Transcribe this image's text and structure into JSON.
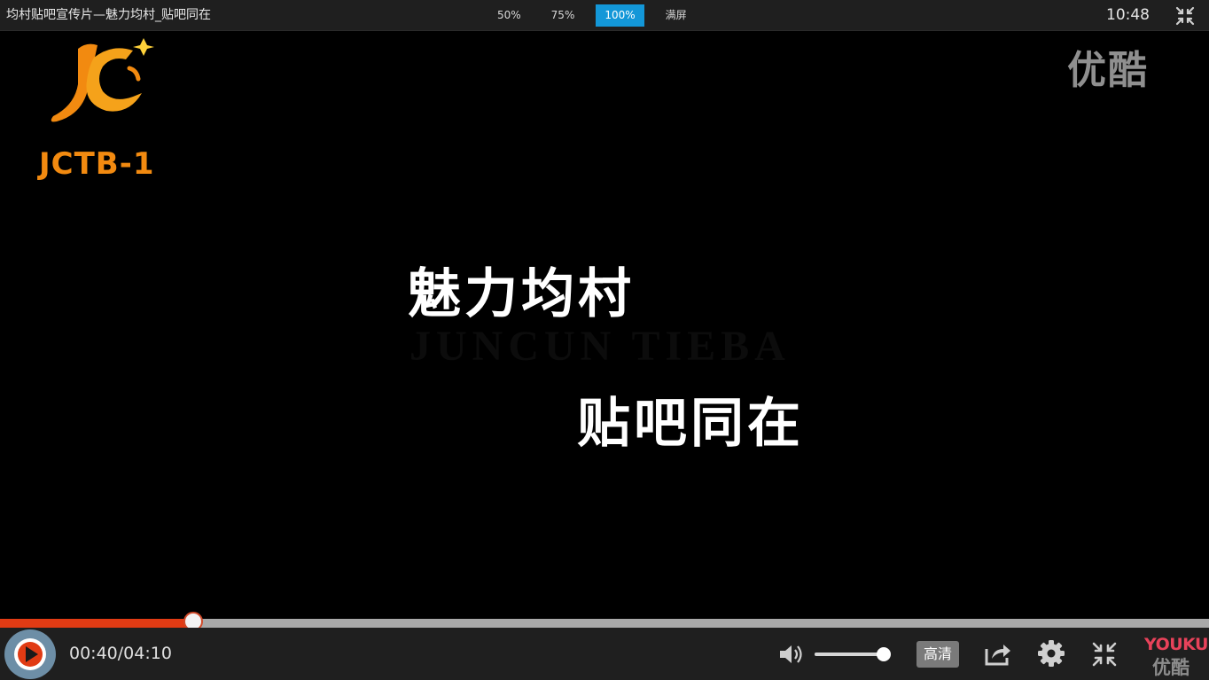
{
  "window": {
    "title": "均村贴吧宣传片—魅力均村_贴吧同在",
    "clock": "10:48"
  },
  "zoom_options": [
    {
      "label": "50%",
      "active": false
    },
    {
      "label": "75%",
      "active": false
    },
    {
      "label": "100%",
      "active": true
    },
    {
      "label": "满屏",
      "active": false
    }
  ],
  "video": {
    "channel_logo_text": "JCTB-1",
    "watermark": "优酷",
    "caption_line1": "魅力均村",
    "caption_ghost": "JUNCUN  TIEBA",
    "caption_line2": "贴吧同在"
  },
  "player": {
    "current_time": "00:40",
    "duration": "04:10",
    "time_display": "00:40/04:10",
    "progress_fraction": 0.16,
    "volume_fraction": 0.98,
    "quality_label": "高清",
    "brand_en": "YOUKU",
    "brand_cn": "优酷"
  },
  "colors": {
    "accent_blue": "#1397d8",
    "progress_red": "#e13b14",
    "logo_orange": "#f28a10",
    "brand_red": "#e8425a"
  },
  "icons": [
    "exit-fullscreen-icon",
    "play-icon",
    "volume-icon",
    "share-icon",
    "gear-icon",
    "shrink-icon"
  ]
}
